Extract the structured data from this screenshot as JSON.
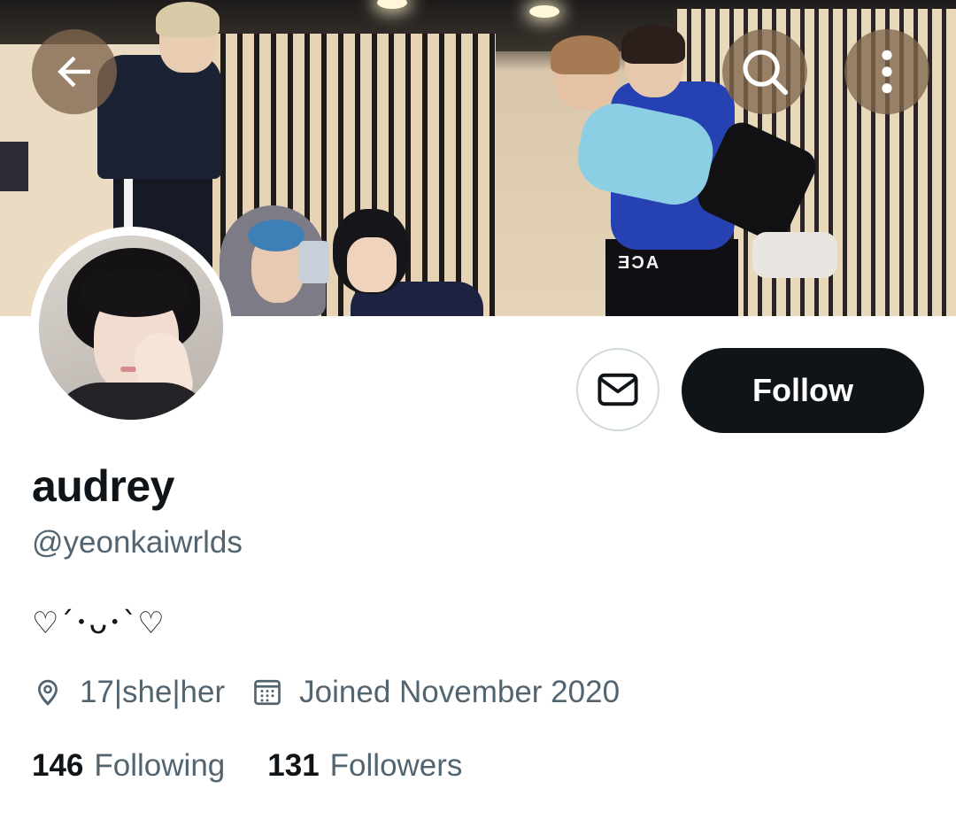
{
  "profile": {
    "name": "audrey",
    "handle": "@yeonkaiwrlds",
    "bio": "♡´･ᴗ･`♡",
    "location": "17|she|her",
    "joined": "Joined November 2020",
    "following_count": "146",
    "following_label": "Following",
    "followers_count": "131",
    "followers_label": "Followers"
  },
  "banner": {
    "shirt_text": "ACE"
  },
  "actions": {
    "follow_label": "Follow"
  },
  "icons": {
    "back": "arrow-left-icon",
    "search": "search-icon",
    "more": "more-vertical-icon",
    "message": "envelope-icon",
    "location": "location-pin-icon",
    "calendar": "calendar-icon"
  },
  "colors": {
    "primary_text": "#0f1419",
    "secondary_text": "#536471",
    "follow_button_bg": "#0f1419",
    "overlay_button_bg": "#80674e"
  }
}
